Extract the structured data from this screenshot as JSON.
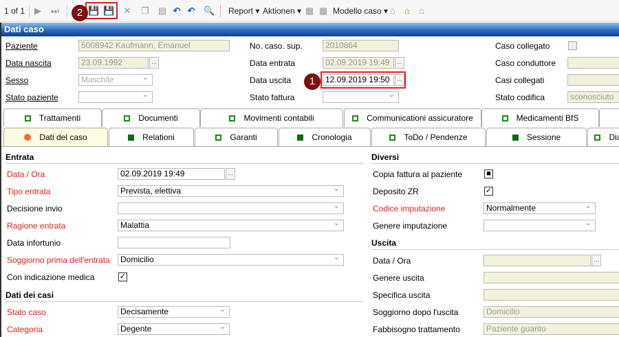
{
  "toolbar": {
    "pager": "1 of 1",
    "report": "Report",
    "aktionen": "Aktionen",
    "modello": "Modello caso",
    "badge2": "2",
    "badge1": "1"
  },
  "title": "Dati caso",
  "header": {
    "paziente": {
      "label": "Paziente",
      "value": "5008942 Kaufmann, Emanuel"
    },
    "data_nascita": {
      "label": "Data nascita",
      "value": "23.09.1992"
    },
    "sesso": {
      "label": "Sesso",
      "value": "Maschile"
    },
    "stato_paziente": {
      "label": "Stato paziente",
      "value": ""
    },
    "no_caso_sup": {
      "label": "No. caso. sup.",
      "value": "2010864"
    },
    "data_entrata": {
      "label": "Data entrata",
      "value": "02.09.2019 19:49"
    },
    "data_uscita": {
      "label": "Data uscita",
      "value": "12.09.2019 19:50"
    },
    "stato_fattura": {
      "label": "Stato fattura",
      "value": ""
    },
    "caso_collegato": {
      "label": "Caso collegato"
    },
    "caso_conduttore": {
      "label": "Caso conduttore",
      "value": ""
    },
    "casi_collegati": {
      "label": "Casi collegati",
      "value": ""
    },
    "stato_codifica": {
      "label": "Stato codifica",
      "value": "sconosciuto"
    }
  },
  "tabs_row1": [
    {
      "label": "Trattamenti",
      "mark": "open"
    },
    {
      "label": "Documenti",
      "mark": "open"
    },
    {
      "label": "Movimenti contabili",
      "mark": "open"
    },
    {
      "label": "Communicationi assicuratore",
      "mark": "open"
    },
    {
      "label": "Medicamenti BfS",
      "mark": "open"
    },
    {
      "label": "",
      "mark": ""
    }
  ],
  "tabs_row2": [
    {
      "label": "Dati del caso",
      "mark": "dot"
    },
    {
      "label": "Relationi",
      "mark": "fill"
    },
    {
      "label": "Garanti",
      "mark": "open"
    },
    {
      "label": "Cronologia",
      "mark": "fill"
    },
    {
      "label": "ToDo / Pendenze",
      "mark": "open"
    },
    {
      "label": "Sessione",
      "mark": "fill"
    },
    {
      "label": "Dia",
      "mark": "open"
    }
  ],
  "left": {
    "entrata_title": "Entrata",
    "rows": [
      {
        "label": "Data / Ora",
        "value": "02.09.2019 19:49",
        "type": "date",
        "required": true
      },
      {
        "label": "Tipo entrata",
        "value": "Prevista, elettiva",
        "type": "select",
        "required": true
      },
      {
        "label": "Decisione invio",
        "value": "",
        "type": "select",
        "required": false
      },
      {
        "label": "Ragione entrata",
        "value": "Malattia",
        "type": "select",
        "required": true
      },
      {
        "label": "Data infortunio",
        "value": "",
        "type": "text",
        "required": false
      },
      {
        "label": "Soggiorno prima dell'entrata",
        "value": "Domicilio",
        "type": "select",
        "required": true
      },
      {
        "label": "Con indicazione medica",
        "value": "✓",
        "type": "check",
        "required": false
      }
    ],
    "casi_title": "Dati dei casi",
    "rows2": [
      {
        "label": "Stato caso",
        "value": "Decisamente",
        "type": "selectshort",
        "required": true
      },
      {
        "label": "Categoria",
        "value": "Degente",
        "type": "selectshort",
        "required": true
      }
    ]
  },
  "right": {
    "diversi_title": "Diversi",
    "rows": [
      {
        "label": "Copia fattura al paziente",
        "value": "■",
        "type": "check",
        "required": false
      },
      {
        "label": "Deposito ZR",
        "value": "✓",
        "type": "check",
        "required": false
      },
      {
        "label": "Codice imputazione",
        "value": "Normalmente",
        "type": "select",
        "required": true
      },
      {
        "label": "Genere imputazione",
        "value": "",
        "type": "select",
        "required": false
      }
    ],
    "uscita_title": "Uscita",
    "rows2": [
      {
        "label": "Data / Ora",
        "value": "",
        "type": "rodate",
        "required": false
      },
      {
        "label": "Genere uscita",
        "value": "",
        "type": "ro",
        "required": false
      },
      {
        "label": "Specifica uscita",
        "value": "",
        "type": "ro",
        "required": false
      },
      {
        "label": "Soggiorno dopo l'uscita",
        "value": "Domicilio",
        "type": "ro",
        "required": false
      },
      {
        "label": "Fabbisogno trattamento",
        "value": "Paziente guarito",
        "type": "ro",
        "required": false
      }
    ]
  }
}
